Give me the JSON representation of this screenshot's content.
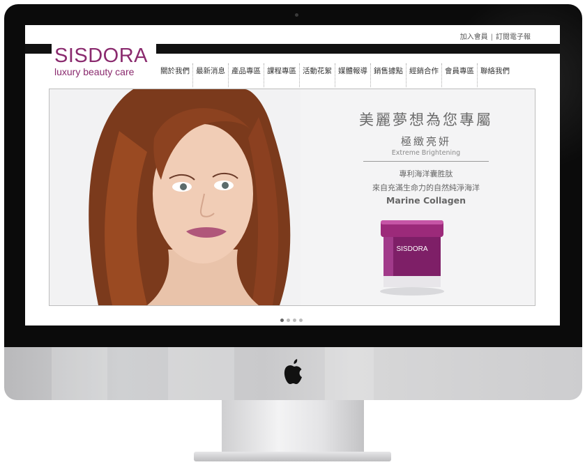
{
  "header": {
    "join_member": "加入會員",
    "separator": "|",
    "subscribe": "訂閱電子報"
  },
  "logo": {
    "title": "SISDORA",
    "subtitle": "luxury beauty care"
  },
  "nav": {
    "items": [
      "關於我們",
      "最新消息",
      "產品專區",
      "課程專區",
      "活動花絮",
      "媒體報導",
      "銷售據點",
      "經銷合作",
      "會員專區",
      "聯絡我們"
    ]
  },
  "banner": {
    "headline": "美麗夢想為您專屬",
    "subheadline": "極緻亮妍",
    "subheadline_en": "Extreme Brightening",
    "line1": "專利海洋囊胜肽",
    "line2": "來自充滿生命力的自然純淨海洋",
    "line3": "Marine Collagen",
    "product_label": "SISDORA"
  },
  "carousel": {
    "slide_count": 4,
    "active_index": 0
  },
  "colors": {
    "brand": "#8a2a6e",
    "bezel": "#0b0b0b",
    "chin": "#cfd0d2"
  }
}
